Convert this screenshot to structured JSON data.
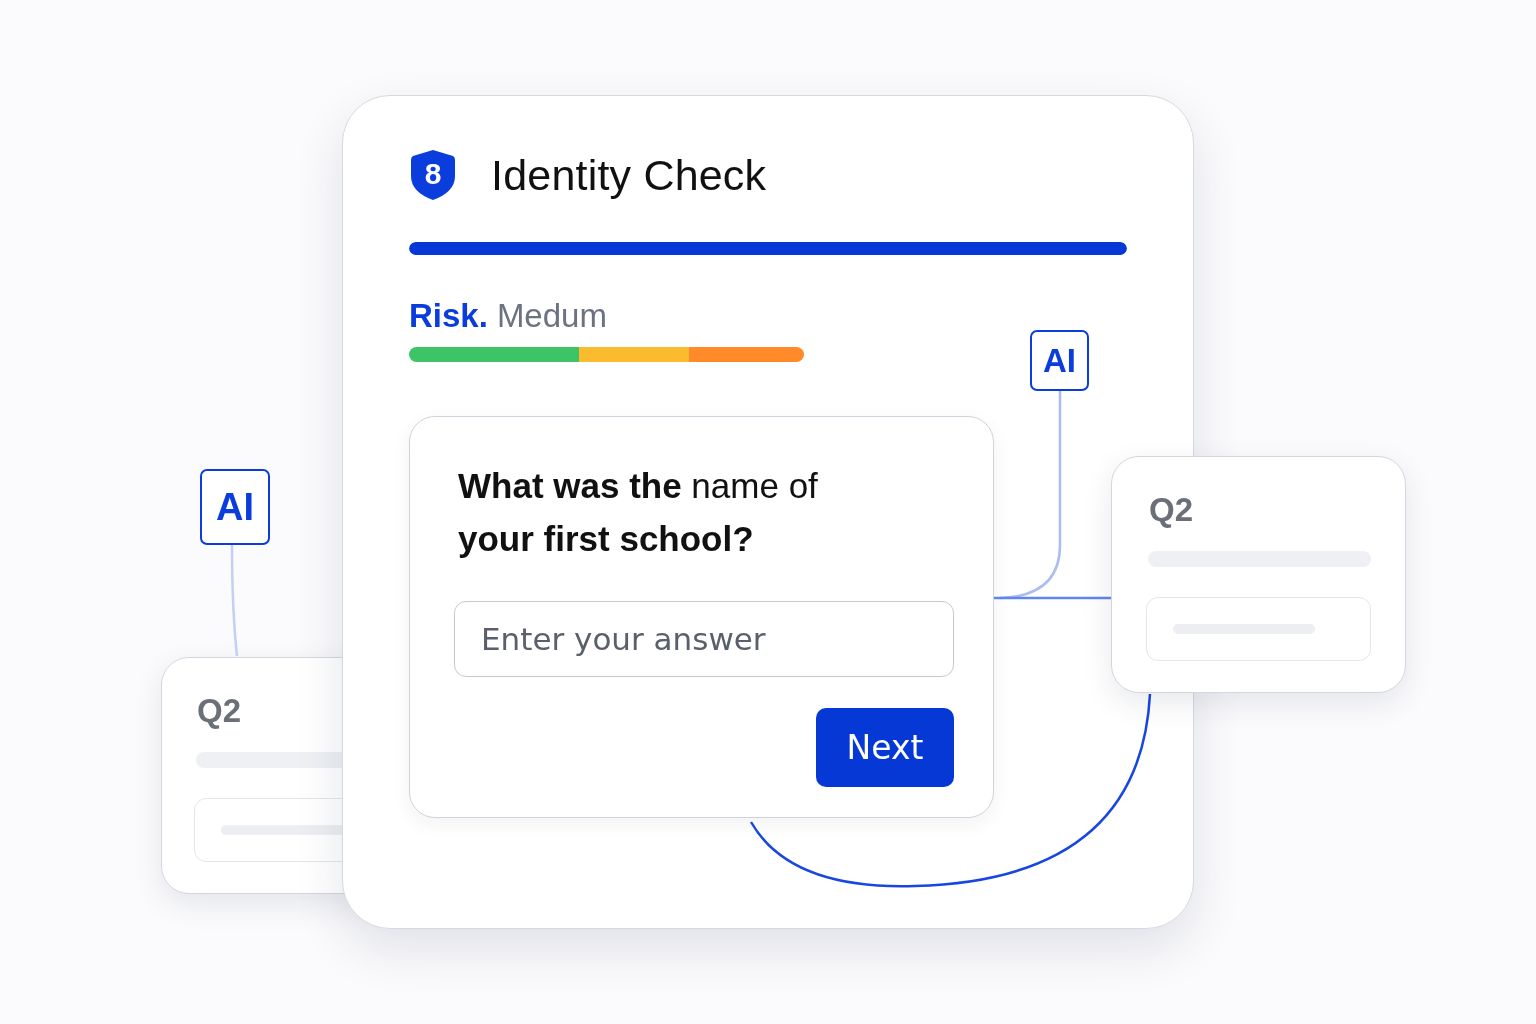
{
  "header": {
    "logo_digit": "8",
    "title": "Identity Check"
  },
  "progress": {
    "level": 1
  },
  "risk": {
    "label": "Risk.",
    "value": "Medum",
    "segments": [
      {
        "color": "#3cc466"
      },
      {
        "color": "#fbbb2e"
      },
      {
        "color": "#ff8a2a"
      }
    ]
  },
  "question": {
    "text": "**What was the** name of **your first school?**",
    "answer": {
      "placeholder": "Enter your answer"
    },
    "button": "Next"
  },
  "ai_badges": [
    "AI",
    "AI"
  ],
  "side_cards": [
    {
      "title": "Q2"
    },
    {
      "title": "Q2"
    }
  ]
}
